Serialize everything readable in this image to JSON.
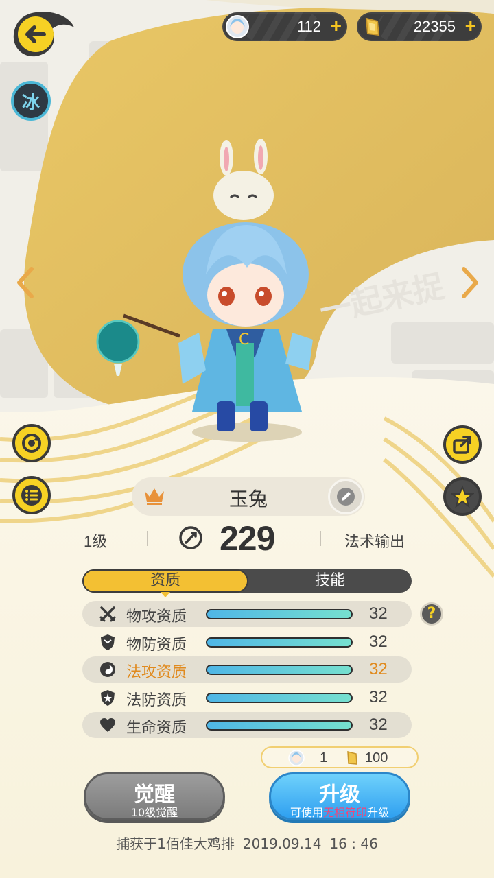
{
  "topbar": {
    "tickets": {
      "value": "112",
      "plus": "+",
      "icon": "character-ticket-icon"
    },
    "coins": {
      "value": "22355",
      "plus": "+",
      "icon": "gold-coin-icon"
    }
  },
  "element_badge": "冰",
  "pet": {
    "name": "玉兔",
    "level": "1级",
    "power": "229",
    "role": "法术输出"
  },
  "tabs": [
    "资质",
    "技能"
  ],
  "stats": [
    {
      "icon": "crossed-swords-icon",
      "label": "物攻资质",
      "value": "32",
      "fill_pct": 100,
      "highlight": false
    },
    {
      "icon": "shield-icon",
      "label": "物防资质",
      "value": "32",
      "fill_pct": 100,
      "highlight": false
    },
    {
      "icon": "magic-orb-icon",
      "label": "法攻资质",
      "value": "32",
      "fill_pct": 100,
      "highlight": true
    },
    {
      "icon": "magic-shield-icon",
      "label": "法防资质",
      "value": "32",
      "fill_pct": 100,
      "highlight": false
    },
    {
      "icon": "heart-icon",
      "label": "生命资质",
      "value": "32",
      "fill_pct": 100,
      "highlight": false
    }
  ],
  "help": "?",
  "cost": {
    "tickets": "1",
    "coins": "100"
  },
  "buttons": {
    "awaken": {
      "label": "觉醒",
      "sub": "10级觉醒"
    },
    "upgrade": {
      "label": "升级",
      "sub_prefix": "可使用",
      "sub_highlight": "无相符印",
      "sub_suffix": "升级"
    }
  },
  "capture": {
    "text": "捕获于1佰佳大鸡排",
    "date": "2019.09.14",
    "time": "16 : 46"
  },
  "colors": {
    "accent_yellow": "#f6d124",
    "highlight_orange": "#e08a1e",
    "upgrade_blue": "#2e9ff0",
    "awaken_gray": "#7b7b7b"
  }
}
